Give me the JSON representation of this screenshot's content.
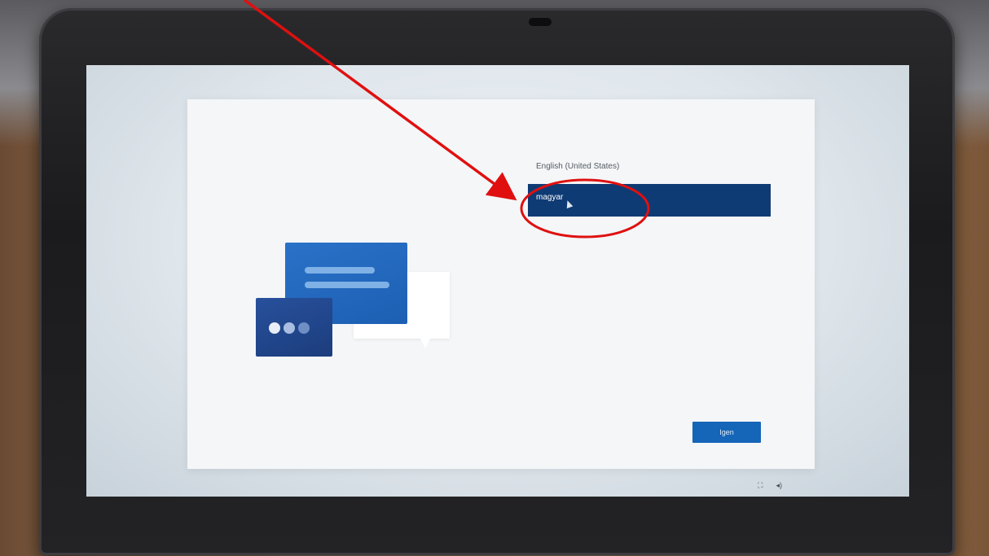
{
  "setup": {
    "languages": [
      {
        "label": "English (United States)",
        "selected": false
      },
      {
        "label": "magyar",
        "selected": true
      }
    ],
    "yes_button_label": "Igen"
  },
  "status_icons": [
    "accessibility-icon",
    "volume-icon"
  ],
  "annotation": {
    "arrow_color": "#e01010",
    "circle_color": "#e01010"
  }
}
